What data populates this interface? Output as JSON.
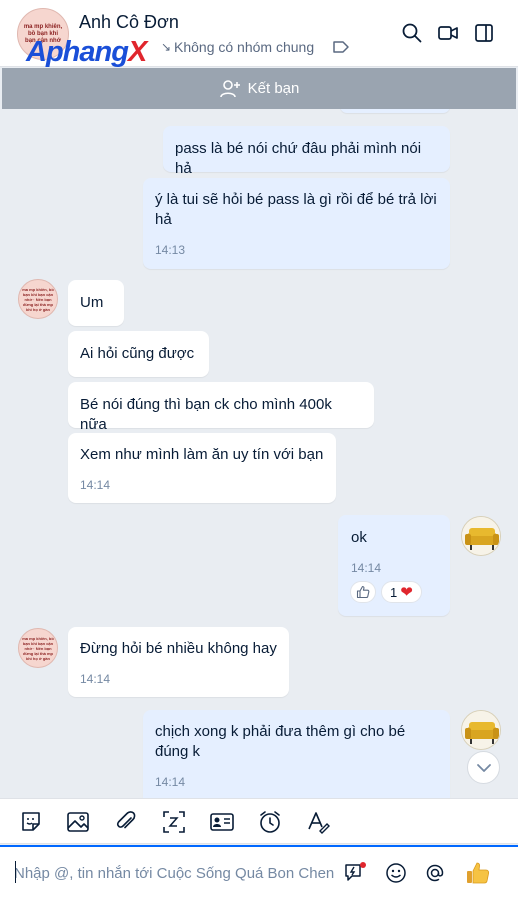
{
  "header": {
    "contact_name": "Anh Cô Đơn",
    "watermark_main": "Aphang",
    "watermark_accent": "X",
    "group_status": "Không có nhóm chung",
    "avatar_caption": "ma mp khiên, bồ bạn khi bạn cận nhớ"
  },
  "friend_bar": {
    "label": "Kết bạn"
  },
  "messages": [
    {
      "sender": "me",
      "text": "pass là bé nói chứ đâu phải mình nói hả"
    },
    {
      "sender": "me",
      "text": "ý là tui sẽ hỏi bé pass là gì rồi để bé trả lời hả",
      "time": "14:13"
    },
    {
      "sender": "them",
      "text": "Um"
    },
    {
      "sender": "them",
      "text": "Ai hỏi cũng được"
    },
    {
      "sender": "them",
      "text": "Bé nói đúng thì bạn ck cho mình 400k nữa"
    },
    {
      "sender": "them",
      "text": "Xem như mình làm ăn uy tín với bạn",
      "time": "14:14"
    },
    {
      "sender": "me",
      "text": "ok",
      "time": "14:14",
      "reaction_count": "1"
    },
    {
      "sender": "them",
      "text": "Đừng hỏi bé nhiều không hay",
      "time": "14:14"
    },
    {
      "sender": "me",
      "text": "chịch xong k phải đưa thêm gì cho bé đúng k",
      "time": "14:14"
    }
  ],
  "avatar_small_caption": "ma mp khiên, bồ bạn khi bạn cận nhớ · Nên bạn đừng lại thà mp khi họ ở gần",
  "composer": {
    "placeholder": "Nhập @, tin nhắn tới Cuộc Sống Quá Bon Chen"
  },
  "colors": {
    "my_bubble": "#e5efff",
    "their_bubble": "#ffffff",
    "chat_background": "#e9edf2",
    "accent": "#0068ff",
    "friend_bar": "#9aa4b0"
  }
}
